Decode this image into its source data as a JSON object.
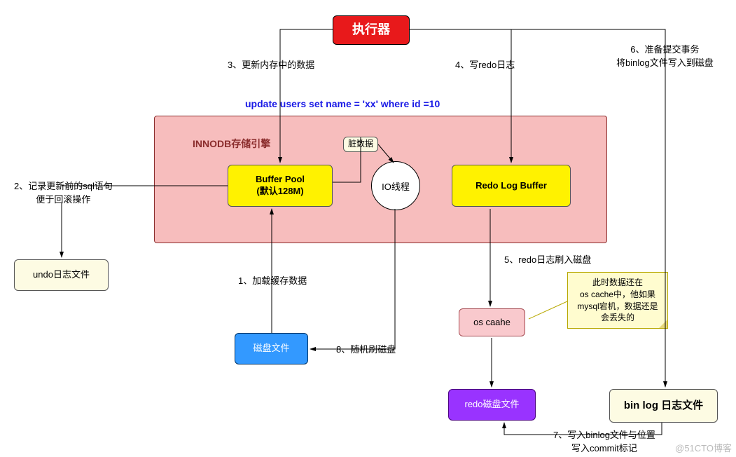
{
  "executor": "执行器",
  "innodb_title": "INNODB存储引擎",
  "sql": "update users set name = 'xx' where id =10",
  "buffer_pool": "Buffer Pool\n(默认128M)",
  "dirty": "脏数据",
  "io_thread": "IO线程",
  "redo_buffer": "Redo Log Buffer",
  "undo_file": "undo日志文件",
  "disk_file": "磁盘文件",
  "os_cache": "os caahe",
  "redo_disk": "redo磁盘文件",
  "binlog_file": "bin log 日志文件",
  "note": "此时数据还在\nos cache中，他如果\nmysql宕机，数据还是\n会丢失的",
  "steps": {
    "s1": "1、加载缓存数据",
    "s2": "2、记录更新前的sql语句\n便于回滚操作",
    "s3": "3、更新内存中的数据",
    "s4": "4、写redo日志",
    "s5": "5、redo日志刷入磁盘",
    "s6": "6、准备提交事务\n将binlog文件写入到磁盘",
    "s7": "7、写入binlog文件与位置\n写入commit标记",
    "s8": "8、随机刷磁盘"
  },
  "watermark": "@51CTO博客"
}
